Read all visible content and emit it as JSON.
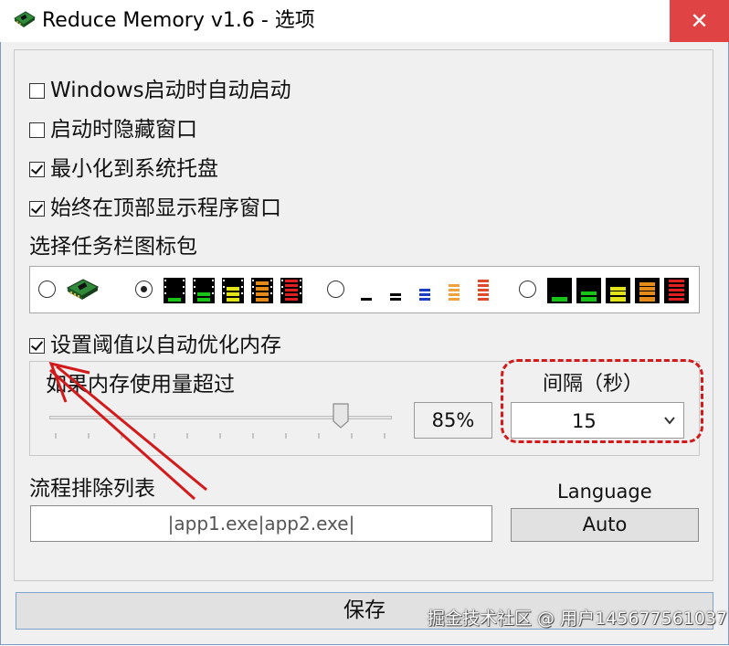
{
  "window": {
    "title": "Reduce Memory v1.6 - 选项",
    "close_glyph": "✕"
  },
  "options": {
    "start_with_windows": {
      "label": "Windows启动时自动启动",
      "checked": false
    },
    "start_hidden": {
      "label": "启动时隐藏窗口",
      "checked": false
    },
    "minimize_to_tray": {
      "label": "最小化到系统托盘",
      "checked": true
    },
    "always_on_top": {
      "label": "始终在顶部显示程序窗口",
      "checked": true
    }
  },
  "icon_pack": {
    "label": "选择任务栏图标包",
    "selected_index": 1,
    "packs": [
      "chip-icon",
      "bar-pack-black-icon",
      "bar-pack-white-icon",
      "bar-pack-dark-icon"
    ]
  },
  "threshold": {
    "label": "设置阈值以自动优化内存",
    "checked": true,
    "usage_label": "如果内存使用量超过",
    "percent": 85,
    "percent_text": "85%",
    "interval_label": "间隔（秒）",
    "interval_value": "15"
  },
  "exclude": {
    "label": "流程排除列表",
    "value": "|app1.exe|app2.exe|"
  },
  "language": {
    "label": "Language",
    "button": "Auto"
  },
  "save_button": "保存",
  "watermark": "掘金技术社区 @ 用户1456775610​37",
  "colors": {
    "close_bg": "#e04343",
    "annotation_red": "#d21a1a",
    "save_border": "#7da2ce"
  }
}
